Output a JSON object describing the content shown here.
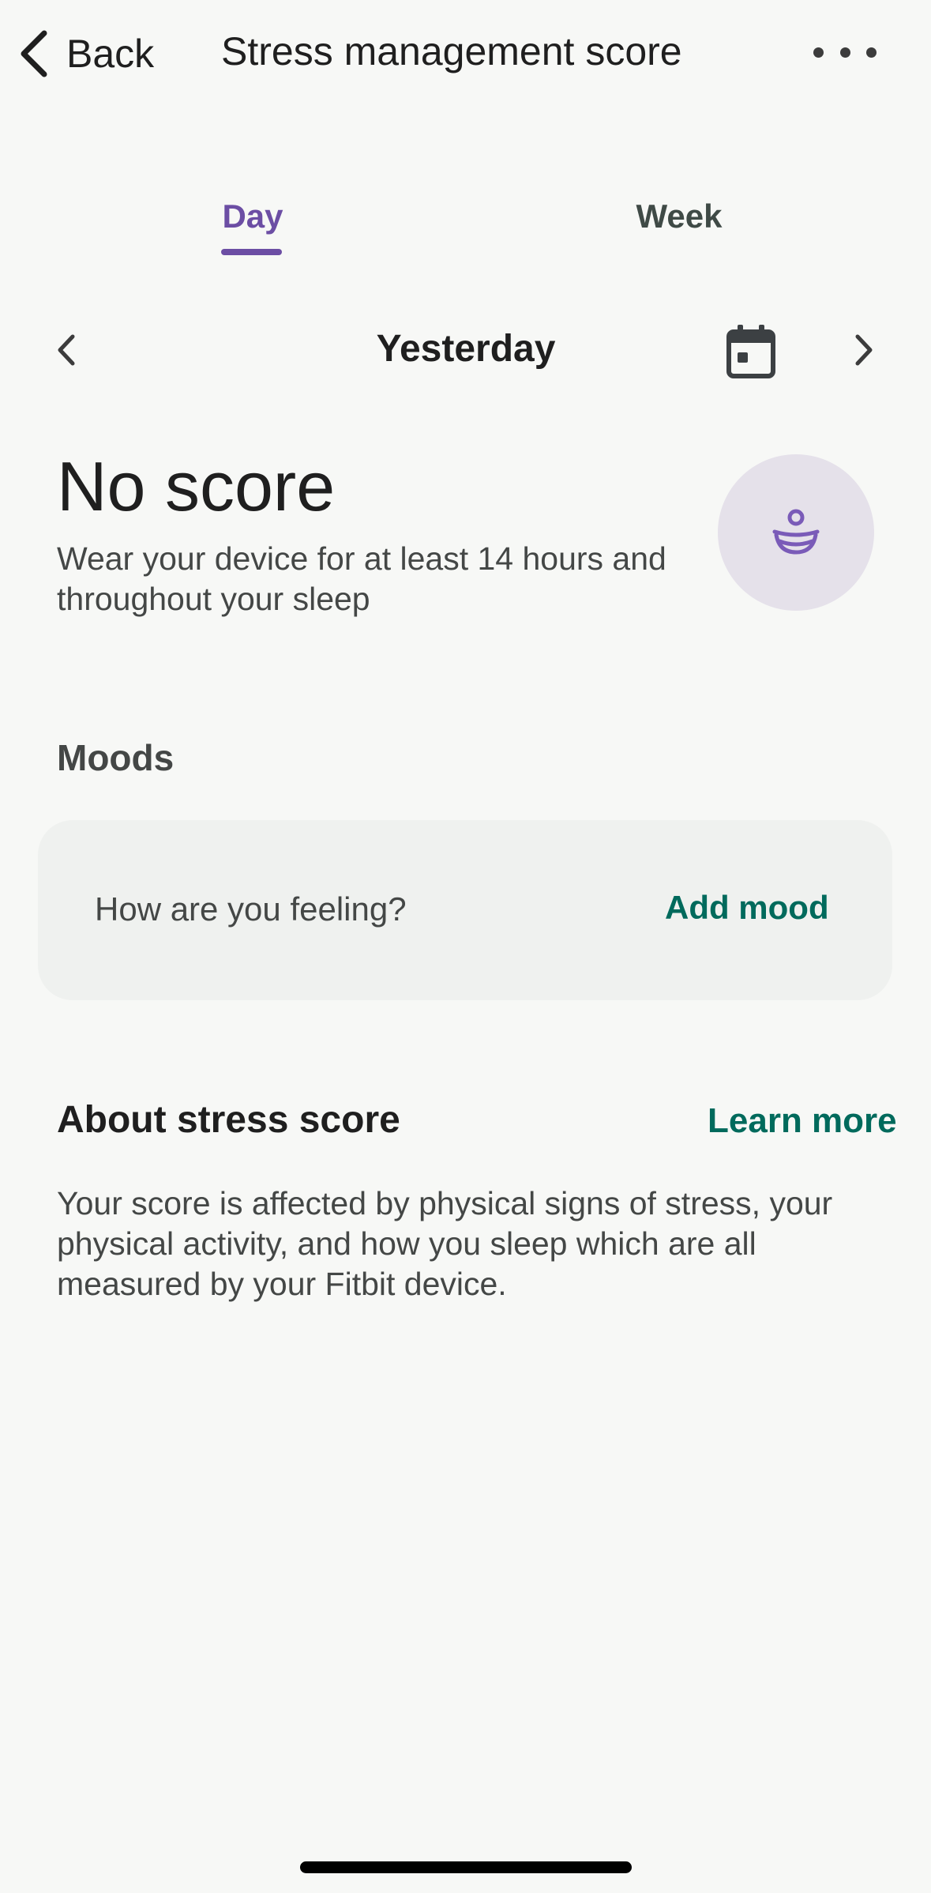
{
  "header": {
    "back_label": "Back",
    "title": "Stress management score",
    "more_icon": "more-horizontal-icon"
  },
  "tabs": [
    {
      "label": "Day",
      "selected": true
    },
    {
      "label": "Week",
      "selected": false
    }
  ],
  "date_nav": {
    "label": "Yesterday",
    "prev_icon": "chevron-left-icon",
    "next_icon": "chevron-right-icon",
    "calendar_icon": "calendar-icon"
  },
  "score": {
    "title": "No score",
    "description": "Wear your device for at least 14 hours and throughout your sleep",
    "badge_icon": "meditation-icon"
  },
  "moods": {
    "heading": "Moods",
    "prompt": "How are you feeling?",
    "add_label": "Add mood"
  },
  "about": {
    "heading": "About stress score",
    "learn_more": "Learn more",
    "body": "Your score is affected by physical signs of stress, your physical activity, and how you sleep which are all measured by your Fitbit device."
  },
  "colors": {
    "background": "#f7f8f6",
    "accent_purple": "#6c4ea4",
    "accent_teal": "#006a5c",
    "badge_bg": "#e5e1ea",
    "card_bg": "#eff1ef"
  }
}
